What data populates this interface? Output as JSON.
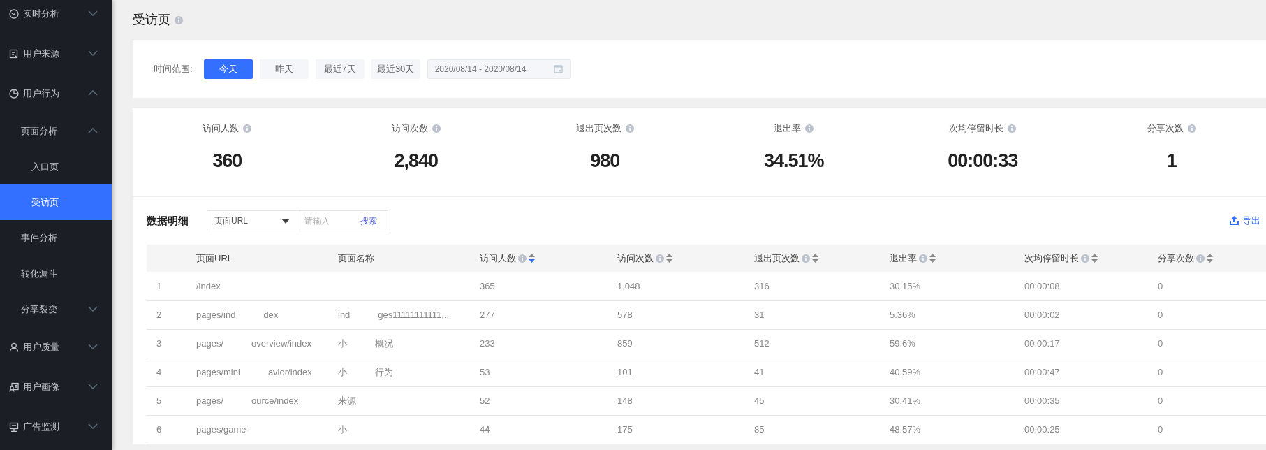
{
  "sidebar": {
    "items": [
      {
        "label": "实时分析",
        "expanded": false,
        "selected": false
      },
      {
        "label": "用户来源",
        "expanded": false,
        "selected": false
      },
      {
        "label": "用户行为",
        "expanded": true,
        "selected": false,
        "children": [
          {
            "label": "页面分析",
            "expanded": true,
            "selected": false,
            "children": [
              {
                "label": "入口页",
                "selected": false
              },
              {
                "label": "受访页",
                "selected": true
              }
            ]
          },
          {
            "label": "事件分析",
            "selected": false
          },
          {
            "label": "转化漏斗",
            "selected": false
          },
          {
            "label": "分享裂变",
            "expanded": false,
            "selected": false
          }
        ]
      },
      {
        "label": "用户质量",
        "expanded": false,
        "selected": false
      },
      {
        "label": "用户画像",
        "expanded": false,
        "selected": false
      },
      {
        "label": "广告监测",
        "expanded": false,
        "selected": false
      }
    ]
  },
  "page_title": "受访页",
  "time_filter": {
    "label": "时间范围:",
    "options": [
      {
        "label": "今天",
        "selected": true
      },
      {
        "label": "昨天",
        "selected": false
      },
      {
        "label": "最近7天",
        "selected": false
      },
      {
        "label": "最近30天",
        "selected": false
      }
    ],
    "date_range": "2020/08/14 - 2020/08/14"
  },
  "stats": [
    {
      "label": "访问人数",
      "value": "360"
    },
    {
      "label": "访问次数",
      "value": "2,840"
    },
    {
      "label": "退出页次数",
      "value": "980"
    },
    {
      "label": "退出率",
      "value": "34.51%"
    },
    {
      "label": "次均停留时长",
      "value": "00:00:33"
    },
    {
      "label": "分享次数",
      "value": "1"
    }
  ],
  "detail": {
    "title": "数据明细",
    "select": "页面URL",
    "search_placeholder": "请输入",
    "search_button": "搜索",
    "export": "导出",
    "columns": [
      {
        "label": "页面URL",
        "info": false,
        "sortable": false
      },
      {
        "label": "页面名称",
        "info": false,
        "sortable": false
      },
      {
        "label": "访问人数",
        "info": true,
        "sortable": true,
        "selected": true
      },
      {
        "label": "访问次数",
        "info": true,
        "sortable": true,
        "selected": false
      },
      {
        "label": "退出页次数",
        "info": true,
        "sortable": true,
        "selected": false
      },
      {
        "label": "退出率",
        "info": true,
        "sortable": true,
        "selected": false
      },
      {
        "label": "次均停留时长",
        "info": true,
        "sortable": true,
        "selected": false
      },
      {
        "label": "分享次数",
        "info": true,
        "sortable": true,
        "selected": false
      }
    ],
    "rows": [
      {
        "index": "1",
        "url": [
          "/index"
        ],
        "values": [
          "365",
          "1,048",
          "316",
          "30.15%",
          "00:00:08",
          "0"
        ]
      },
      {
        "index": "2",
        "url": [
          "pages/ind",
          "dex"
        ],
        "name": [
          "ind",
          "ges11111111111..."
        ],
        "values": [
          "277",
          "578",
          "31",
          "5.36%",
          "00:00:02",
          "0"
        ]
      },
      {
        "index": "3",
        "url": [
          "pages/",
          "overview/index"
        ],
        "name": [
          "小",
          "概况"
        ],
        "values": [
          "233",
          "859",
          "512",
          "59.6%",
          "00:00:17",
          "0"
        ]
      },
      {
        "index": "4",
        "url": [
          "pages/mini",
          "avior/index"
        ],
        "name": [
          "小",
          "行为"
        ],
        "values": [
          "53",
          "101",
          "41",
          "40.59%",
          "00:00:47",
          "0"
        ]
      },
      {
        "index": "5",
        "url": [
          "pages/",
          "ource/index"
        ],
        "name": [
          "来源"
        ],
        "values": [
          "52",
          "148",
          "45",
          "30.41%",
          "00:00:35",
          "0"
        ]
      },
      {
        "index": "6",
        "url": [
          "pages/game-"
        ],
        "name": [
          "小"
        ],
        "values": [
          "44",
          "175",
          "85",
          "48.57%",
          "00:00:25",
          "0"
        ]
      }
    ]
  }
}
